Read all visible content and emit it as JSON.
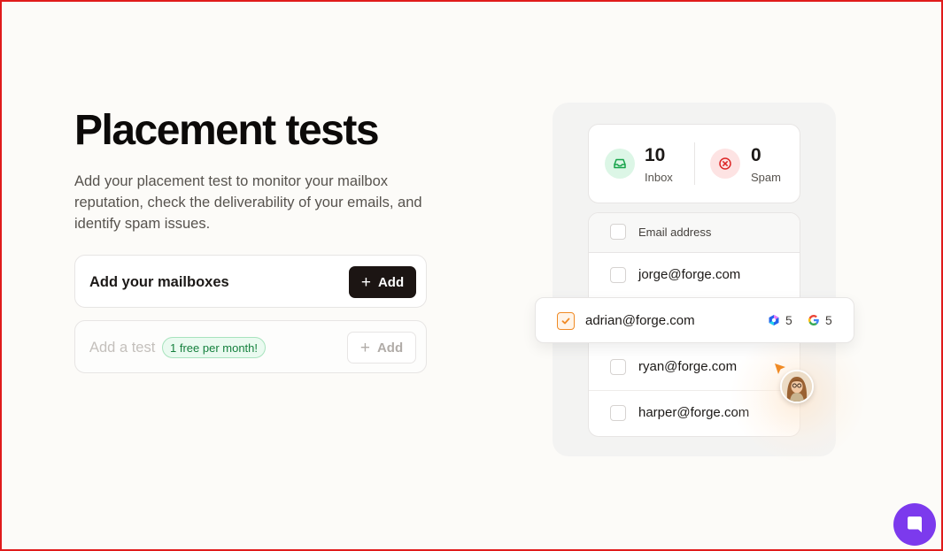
{
  "header": {
    "title": "Placement tests",
    "description": "Add your placement test to monitor your mailbox reputation, check the deliverability of your emails, and identify spam issues."
  },
  "cards": {
    "mailboxes": {
      "label": "Add your mailboxes",
      "button": "Add"
    },
    "test": {
      "label": "Add a test",
      "badge": "1 free per month!",
      "button": "Add"
    }
  },
  "illustration": {
    "stats": {
      "inbox": {
        "count": "10",
        "label": "Inbox"
      },
      "spam": {
        "count": "0",
        "label": "Spam"
      }
    },
    "list": {
      "header": "Email address",
      "rows": [
        "jorge@forge.com",
        "ryan@forge.com",
        "harper@forge.com"
      ]
    },
    "highlighted": {
      "email": "adrian@forge.com",
      "outlook_count": "5",
      "google_count": "5"
    }
  },
  "colors": {
    "accent_dark": "#1c1513",
    "badge_green": "#15803d",
    "check_orange": "#f08a24",
    "chat_purple": "#7c3aed"
  },
  "icons": [
    "plus-icon",
    "inbox-icon",
    "spam-x-icon",
    "check-icon",
    "outlook-icon",
    "google-icon",
    "cursor-arrow-icon",
    "chat-icon"
  ]
}
